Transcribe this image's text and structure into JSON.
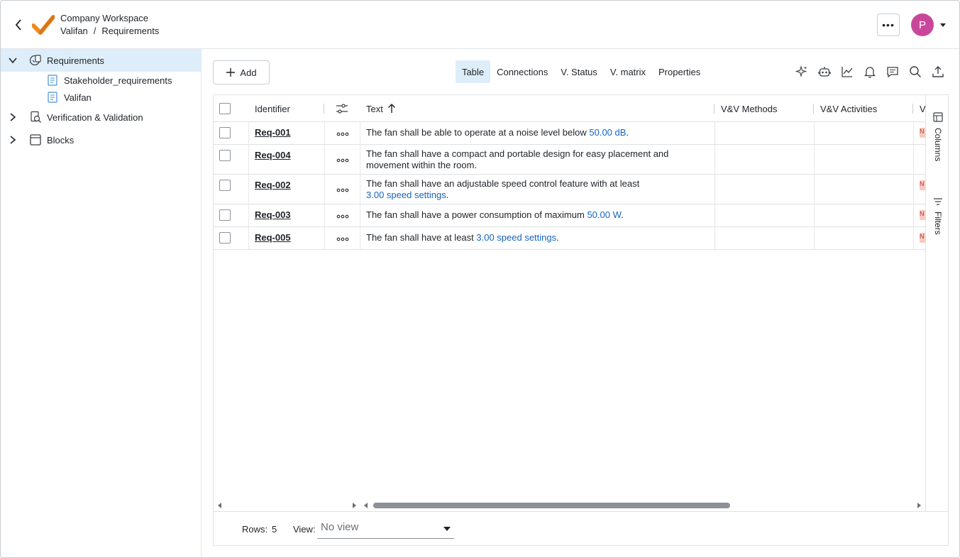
{
  "header": {
    "workspace_title": "Company Workspace",
    "breadcrumb": [
      "Valifan",
      "Requirements"
    ],
    "breadcrumb_separator": "/",
    "more_label": "•••",
    "avatar_initial": "P",
    "avatar_color": "#c9479a"
  },
  "sidebar": {
    "items": [
      {
        "label": "Requirements",
        "icon": "requirements-icon",
        "expanded": true,
        "selected": true
      },
      {
        "label": "Stakeholder_requirements",
        "icon": "document-icon"
      },
      {
        "label": "Valifan",
        "icon": "document-icon"
      },
      {
        "label": "Verification & Validation",
        "icon": "verification-icon",
        "expanded": false
      },
      {
        "label": "Blocks",
        "icon": "block-icon",
        "expanded": false
      }
    ]
  },
  "toolbar": {
    "add_label": "Add",
    "tabs": [
      "Table",
      "Connections",
      "V. Status",
      "V. matrix",
      "Properties"
    ],
    "active_tab": "Table",
    "icons": [
      "sparkle-icon",
      "robot-icon",
      "chart-icon",
      "bell-icon",
      "comment-icon",
      "search-icon",
      "export-icon"
    ]
  },
  "table": {
    "columns": {
      "identifier": "Identifier",
      "text": "Text",
      "vv_methods": "V&V Methods",
      "vv_activities": "V&V Activities",
      "partial": "V"
    },
    "rows": [
      {
        "id": "Req-001",
        "parts": [
          {
            "t": "The fan shall be able to operate at a noise level below "
          },
          {
            "v": "50.00  dB"
          },
          {
            "t": "."
          }
        ],
        "tag": "N"
      },
      {
        "id": "Req-004",
        "parts": [
          {
            "t": "The fan shall have a compact and portable design for easy placement and movement within the room."
          }
        ],
        "tag": ""
      },
      {
        "id": "Req-002",
        "parts": [
          {
            "t": "The fan shall have an adjustable speed control feature with at least "
          },
          {
            "v": "3.00  speed settings"
          },
          {
            "t": "."
          }
        ],
        "tag": "N"
      },
      {
        "id": "Req-003",
        "parts": [
          {
            "t": "The fan shall have a power consumption of maximum "
          },
          {
            "v": "50.00  W"
          },
          {
            "t": "."
          }
        ],
        "tag": "N"
      },
      {
        "id": "Req-005",
        "parts": [
          {
            "t": "The fan shall have at least "
          },
          {
            "v": "3.00  speed settings"
          },
          {
            "t": "."
          }
        ],
        "tag": "N"
      }
    ],
    "side_panel": [
      "Columns",
      "Filters"
    ]
  },
  "footer": {
    "rows_label": "Rows:",
    "rows_value": "5",
    "view_label": "View:",
    "view_placeholder": "No view"
  }
}
